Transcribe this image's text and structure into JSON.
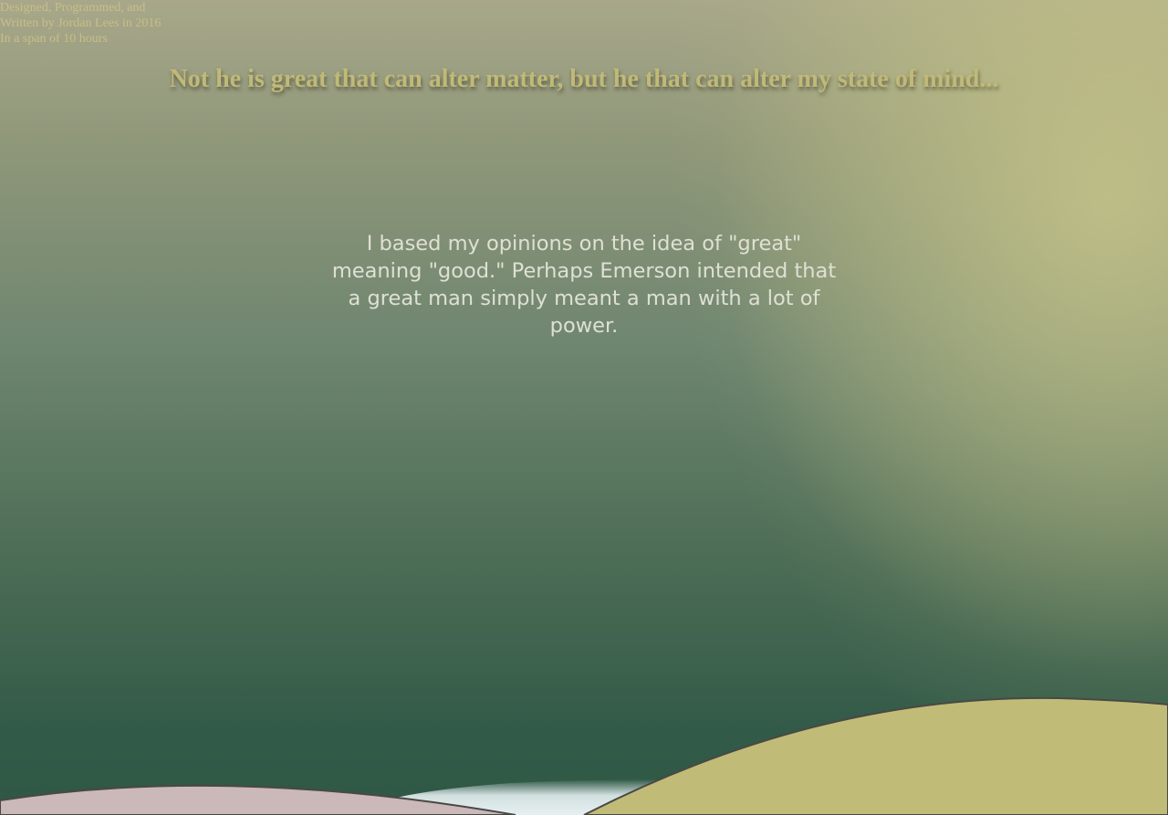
{
  "credits": {
    "line1": "Designed, Programmed, and",
    "line2": "Written by Jordan Lees in 2016",
    "line3": "In a span of 10 hours"
  },
  "quote": "Not he is great that can alter matter, but he that can alter my state of mind...",
  "opinion": "I based my opinions on the idea of \"great\" meaning \"good.\" Perhaps Emerson intended that a great man simply meant a man with a lot of power.",
  "colors": {
    "background_top": "#a8a78a",
    "background_bottom": "#2e5845",
    "quote_text": "#c0b978",
    "body_text": "#dfe0d4",
    "hill_left": "#cbb8b8",
    "hill_right": "#c0bc78",
    "river": "#e3eef0",
    "outline": "#4a4844"
  }
}
